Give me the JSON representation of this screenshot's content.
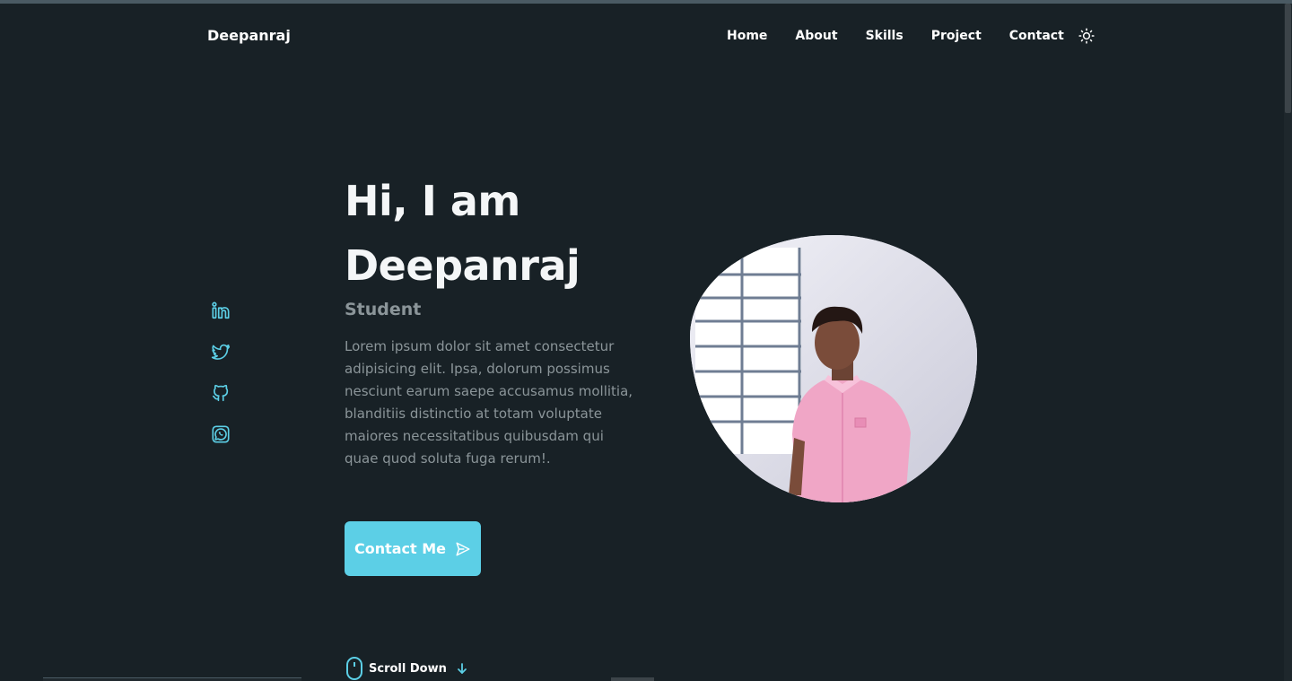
{
  "header": {
    "logo": "Deepanraj",
    "nav": [
      {
        "label": "Home"
      },
      {
        "label": "About"
      },
      {
        "label": "Skills"
      },
      {
        "label": "Project"
      },
      {
        "label": "Contact"
      }
    ],
    "theme_toggle_icon": "sun-icon"
  },
  "social": [
    {
      "icon": "linkedin-icon"
    },
    {
      "icon": "twitter-icon"
    },
    {
      "icon": "github-icon"
    },
    {
      "icon": "whatsapp-icon"
    }
  ],
  "hero": {
    "title_line1": "Hi, I am",
    "title_line2": "Deepanraj",
    "subtitle": "Student",
    "description": "Lorem ipsum dolor sit amet consectetur adipisicing elit. Ipsa, dolorum possimus nesciunt earum saepe accusamus mollitia, blanditiis distinctio at totam voluptate maiores necessitatibus quibusdam qui quae quod soluta fuga rerum!.",
    "button_label": "Contact Me",
    "button_icon": "send-icon",
    "profile_image": "profile-photo"
  },
  "scroll": {
    "label": "Scroll Down",
    "mouse_icon": "mouse-icon",
    "arrow_icon": "arrow-down-icon"
  },
  "colors": {
    "background": "#182126",
    "accent": "#5ccfe6",
    "text": "#ffffff",
    "muted": "#8b9599"
  }
}
